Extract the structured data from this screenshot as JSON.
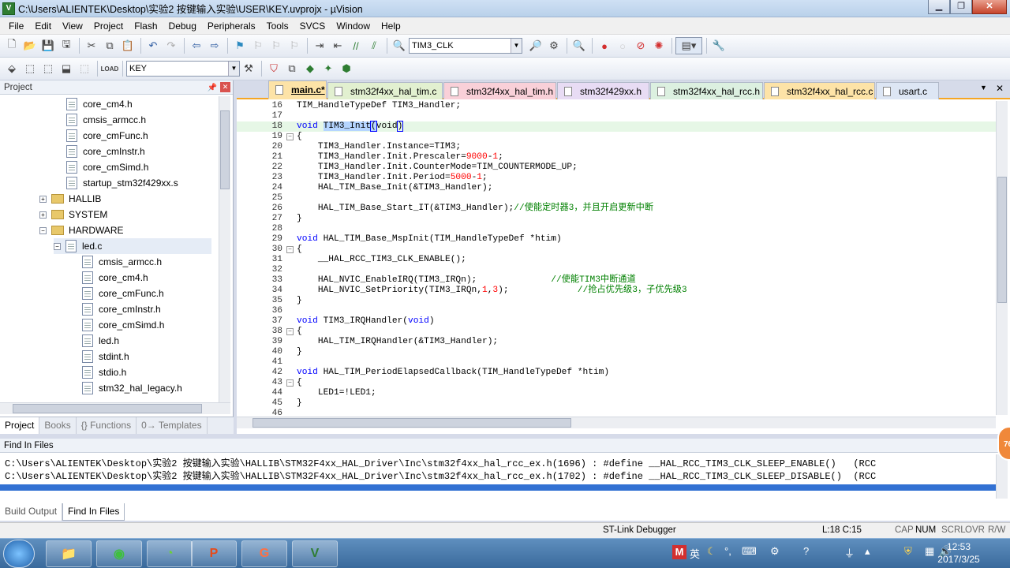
{
  "window": {
    "title": "C:\\Users\\ALIENTEK\\Desktop\\实验2 按键输入实验\\USER\\KEY.uvprojx - µVision",
    "min": "▁",
    "max": "❐",
    "close": "✕"
  },
  "menu": [
    "File",
    "Edit",
    "View",
    "Project",
    "Flash",
    "Debug",
    "Peripherals",
    "Tools",
    "SVCS",
    "Window",
    "Help"
  ],
  "toolbar": {
    "find_combo": "TIM3_CLK",
    "target_combo": "KEY"
  },
  "project_panel": {
    "title": "Project",
    "tabs": [
      "Project",
      "Books",
      "{} Functions",
      "0→ Templates"
    ],
    "items": [
      {
        "label": "core_cm4.h",
        "kind": "file",
        "indent": 1
      },
      {
        "label": "cmsis_armcc.h",
        "kind": "file",
        "indent": 1
      },
      {
        "label": "core_cmFunc.h",
        "kind": "file",
        "indent": 1
      },
      {
        "label": "core_cmInstr.h",
        "kind": "file",
        "indent": 1
      },
      {
        "label": "core_cmSimd.h",
        "kind": "file",
        "indent": 1
      },
      {
        "label": "startup_stm32f429xx.s",
        "kind": "file",
        "indent": 1
      },
      {
        "label": "HALLIB",
        "kind": "folder",
        "indent": 0,
        "exp": "+"
      },
      {
        "label": "SYSTEM",
        "kind": "folder",
        "indent": 0,
        "exp": "+"
      },
      {
        "label": "HARDWARE",
        "kind": "folder",
        "indent": 0,
        "exp": "−"
      },
      {
        "label": "led.c",
        "kind": "file",
        "indent": 1,
        "exp": "−"
      },
      {
        "label": "cmsis_armcc.h",
        "kind": "file",
        "indent": 2
      },
      {
        "label": "core_cm4.h",
        "kind": "file",
        "indent": 2
      },
      {
        "label": "core_cmFunc.h",
        "kind": "file",
        "indent": 2
      },
      {
        "label": "core_cmInstr.h",
        "kind": "file",
        "indent": 2
      },
      {
        "label": "core_cmSimd.h",
        "kind": "file",
        "indent": 2
      },
      {
        "label": "led.h",
        "kind": "file",
        "indent": 2
      },
      {
        "label": "stdint.h",
        "kind": "file",
        "indent": 2
      },
      {
        "label": "stdio.h",
        "kind": "file",
        "indent": 2
      },
      {
        "label": "stm32_hal_legacy.h",
        "kind": "file",
        "indent": 2
      }
    ]
  },
  "editor": {
    "tabs": [
      {
        "label": "main.c*",
        "color": "#fde3a7",
        "active": true
      },
      {
        "label": "stm32f4xx_hal_tim.c",
        "color": "#e2f0d0"
      },
      {
        "label": "stm32f4xx_hal_tim.h",
        "color": "#f9d0d8"
      },
      {
        "label": "stm32f429xx.h",
        "color": "#e8dcf4"
      },
      {
        "label": "stm32f4xx_hal_rcc.h",
        "color": "#dcf0e0"
      },
      {
        "label": "stm32f4xx_hal_rcc.c",
        "color": "#fde3a7"
      },
      {
        "label": "usart.c",
        "color": "#dde6f4"
      }
    ],
    "lines": [
      {
        "n": "16",
        "f": "",
        "t": "TIM_HandleTypeDef TIM3_Handler;"
      },
      {
        "n": "17",
        "f": "",
        "t": ""
      },
      {
        "n": "18",
        "f": "",
        "t": "void TIM3_Init(void)"
      },
      {
        "n": "19",
        "f": "−",
        "t": "{"
      },
      {
        "n": "20",
        "f": "",
        "t": "    TIM3_Handler.Instance=TIM3;"
      },
      {
        "n": "21",
        "f": "",
        "t": "    TIM3_Handler.Init.Prescaler=9000-1;"
      },
      {
        "n": "22",
        "f": "",
        "t": "    TIM3_Handler.Init.CounterMode=TIM_COUNTERMODE_UP;"
      },
      {
        "n": "23",
        "f": "",
        "t": "    TIM3_Handler.Init.Period=5000-1;"
      },
      {
        "n": "24",
        "f": "",
        "t": "    HAL_TIM_Base_Init(&TIM3_Handler);"
      },
      {
        "n": "25",
        "f": "",
        "t": ""
      },
      {
        "n": "26",
        "f": "",
        "t": "    HAL_TIM_Base_Start_IT(&TIM3_Handler);",
        "c": "//使能定时器3，并且开启更新中断"
      },
      {
        "n": "27",
        "f": "",
        "t": "}"
      },
      {
        "n": "28",
        "f": "",
        "t": ""
      },
      {
        "n": "29",
        "f": "",
        "t": "void HAL_TIM_Base_MspInit(TIM_HandleTypeDef *htim)"
      },
      {
        "n": "30",
        "f": "−",
        "t": "{"
      },
      {
        "n": "31",
        "f": "",
        "t": "    __HAL_RCC_TIM3_CLK_ENABLE();"
      },
      {
        "n": "32",
        "f": "",
        "t": ""
      },
      {
        "n": "33",
        "f": "",
        "t": "    HAL_NVIC_EnableIRQ(TIM3_IRQn);              ",
        "c": "//使能TIM3中断通道"
      },
      {
        "n": "34",
        "f": "",
        "t": "    HAL_NVIC_SetPriority(TIM3_IRQn,1,3);             ",
        "c": "//抢占优先级3，子优先级3"
      },
      {
        "n": "35",
        "f": "",
        "t": "}"
      },
      {
        "n": "36",
        "f": "",
        "t": ""
      },
      {
        "n": "37",
        "f": "",
        "t": "void TIM3_IRQHandler(void)"
      },
      {
        "n": "38",
        "f": "−",
        "t": "{"
      },
      {
        "n": "39",
        "f": "",
        "t": "    HAL_TIM_IRQHandler(&TIM3_Handler);"
      },
      {
        "n": "40",
        "f": "",
        "t": "}"
      },
      {
        "n": "41",
        "f": "",
        "t": ""
      },
      {
        "n": "42",
        "f": "",
        "t": "void HAL_TIM_PeriodElapsedCallback(TIM_HandleTypeDef *htim)"
      },
      {
        "n": "43",
        "f": "−",
        "t": "{"
      },
      {
        "n": "44",
        "f": "",
        "t": "    LED1=!LED1;"
      },
      {
        "n": "45",
        "f": "",
        "t": "}"
      },
      {
        "n": "46",
        "f": "",
        "t": ""
      }
    ]
  },
  "find_in_files": {
    "title": "Find In Files",
    "lines": [
      "C:\\Users\\ALIENTEK\\Desktop\\实验2 按键输入实验\\HALLIB\\STM32F4xx_HAL_Driver\\Inc\\stm32f4xx_hal_rcc_ex.h(1696) : #define __HAL_RCC_TIM3_CLK_SLEEP_ENABLE()   (RCC",
      "C:\\Users\\ALIENTEK\\Desktop\\实验2 按键输入实验\\HALLIB\\STM32F4xx_HAL_Driver\\Inc\\stm32f4xx_hal_rcc_ex.h(1702) : #define __HAL_RCC_TIM3_CLK_SLEEP_DISABLE()  (RCC"
    ],
    "tabs": [
      "Build Output",
      "Find In Files"
    ]
  },
  "status": {
    "debugger": "ST-Link Debugger",
    "position": "L:18 C:15",
    "caps": "CAP",
    "num": "NUM",
    "scrl": "SCRL",
    "ovr": "OVR",
    "rw": "R/W"
  },
  "taskbar": {
    "time": "12:53",
    "date": "2017/3/25",
    "ime": "英",
    "apps": [
      "explorer",
      "360",
      "browser",
      "powerpoint",
      "pdf",
      "uvision"
    ]
  },
  "badge": "76"
}
